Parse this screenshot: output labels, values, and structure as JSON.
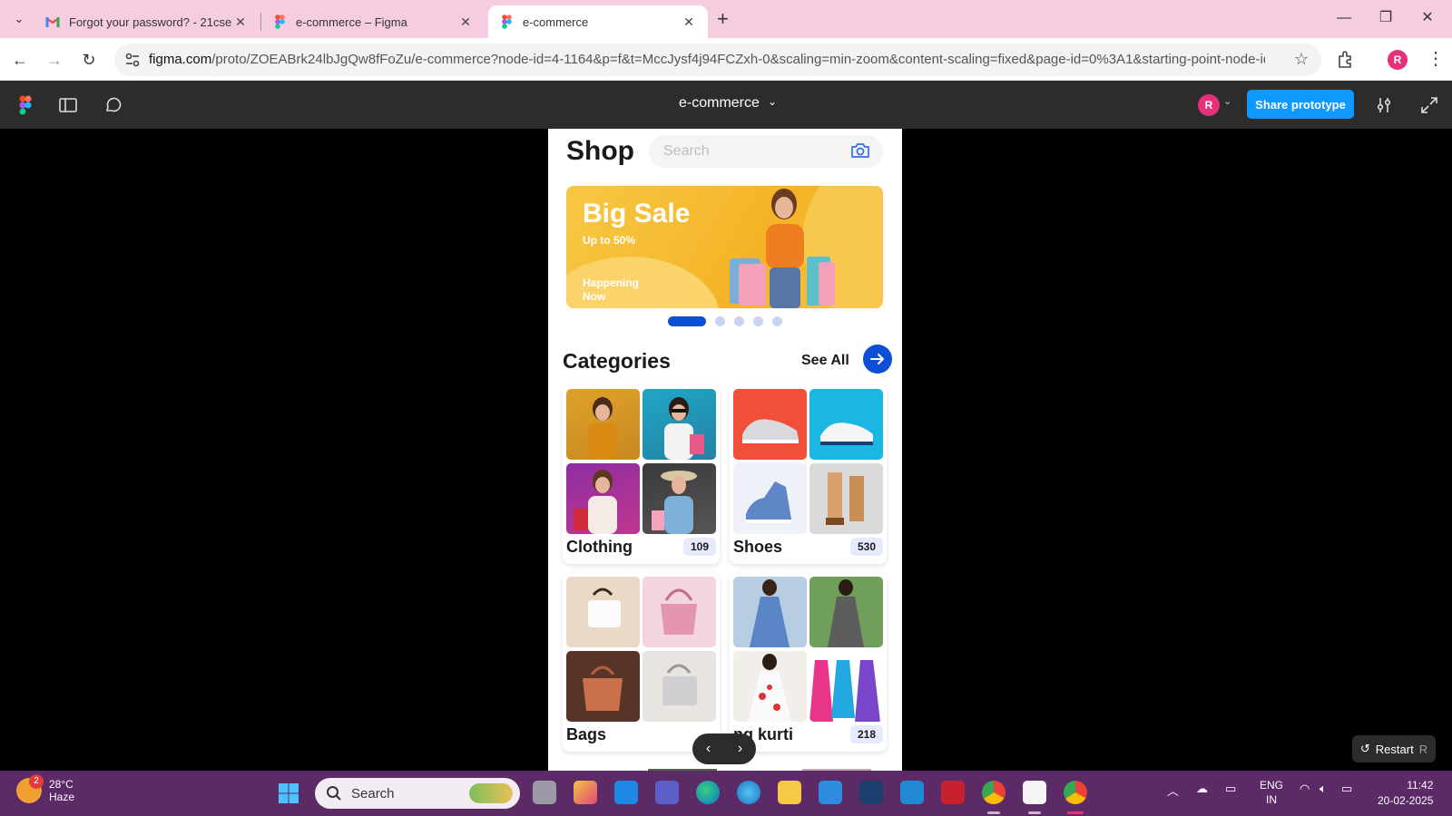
{
  "browser": {
    "tabs": [
      {
        "title": "Forgot your password? - 21cse",
        "icon": "gmail-icon"
      },
      {
        "title": "e-commerce – Figma",
        "icon": "figma-icon"
      },
      {
        "title": "e-commerce",
        "icon": "figma-icon",
        "active": true
      }
    ],
    "url_host": "figma.com",
    "url_path": "/proto/ZOEABrk24lbJgQw8fFoZu/e-commerce?node-id=4-1164&p=f&t=MccJysf4j94FCZxh-0&scaling=min-zoom&content-scaling=fixed&page-id=0%3A1&starting-point-node-id...",
    "profile_initial": "R"
  },
  "figma": {
    "file_title": "e-commerce",
    "user_initial": "R",
    "share_label": "Share prototype",
    "restart_label": "Restart",
    "restart_key": "R"
  },
  "app": {
    "title": "Shop",
    "search_placeholder": "Search",
    "banner": {
      "headline": "Big Sale",
      "subline": "Up to 50%",
      "tagline": "Happening Now"
    },
    "carousel": {
      "count": 5,
      "active_index": 0
    },
    "categories_title": "Categories",
    "see_all_label": "See All",
    "categories": [
      {
        "name": "Clothing",
        "count": "109"
      },
      {
        "name": "Shoes",
        "count": "530"
      },
      {
        "name": "Bags",
        "count": ""
      },
      {
        "name": "ng kurti",
        "count": "218"
      }
    ]
  },
  "taskbar": {
    "temperature": "28°C",
    "condition": "Haze",
    "notification_count": "2",
    "search_label": "Search",
    "lang_top": "ENG",
    "lang_bottom": "IN",
    "time": "11:42",
    "date": "20-02-2025"
  },
  "colors": {
    "tabstrip": "#f6cde0",
    "figma_bar": "#2c2c2c",
    "accent_blue": "#0b4fd6",
    "share_blue": "#0d99ff",
    "banner_yellow": "#f5b326",
    "taskbar": "#5b2a67"
  }
}
